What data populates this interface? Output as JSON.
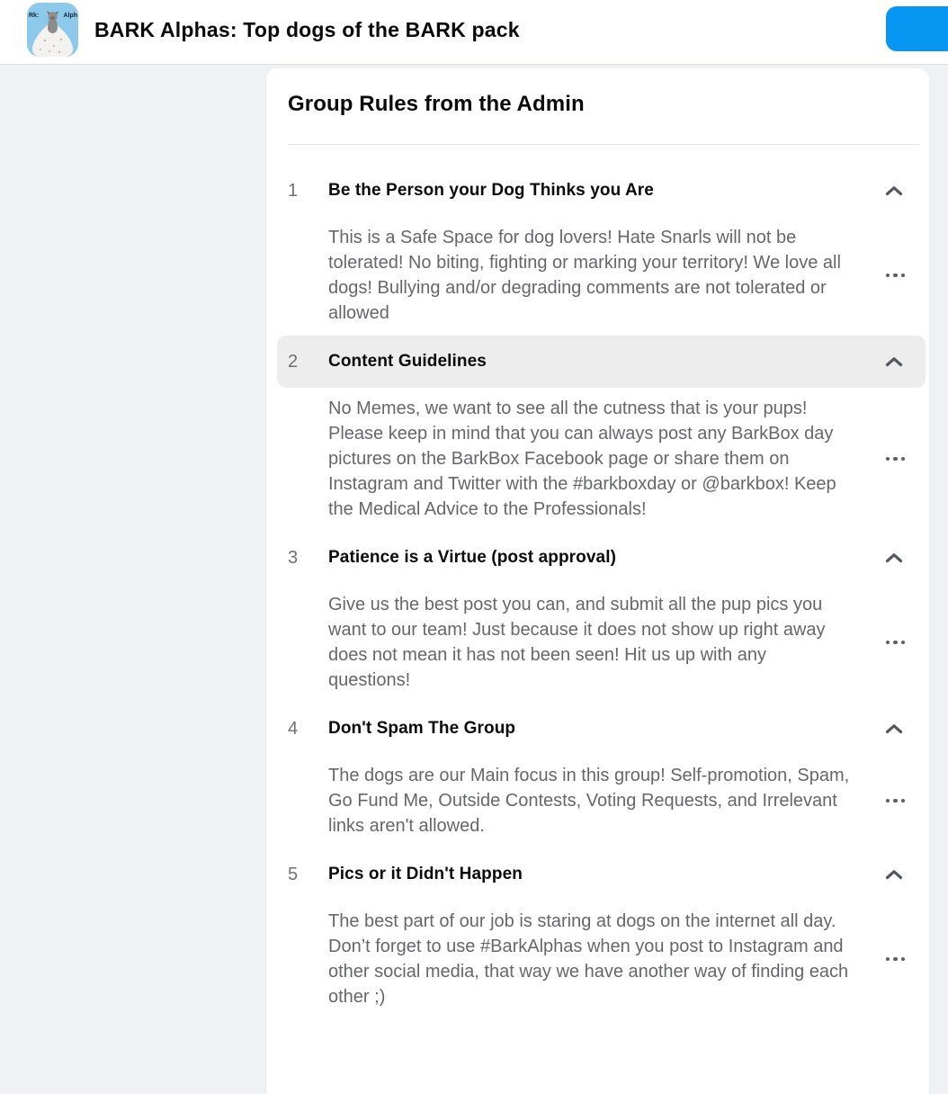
{
  "header": {
    "group_title": "BARK Alphas: Top dogs of the BARK pack",
    "avatar_text_left": "Rk:",
    "avatar_text_right": "Alph"
  },
  "rules_card": {
    "title": "Group Rules from the Admin",
    "rules": [
      {
        "number": "1",
        "title": "Be the Person your Dog Thinks you Are",
        "description": "This is a Safe Space for dog lovers! Hate Snarls will not be tolerated! No biting, fighting or marking your territory! We love all dogs! Bullying and/or degrading comments are not tolerated or allowed",
        "highlighted": false
      },
      {
        "number": "2",
        "title": "Content Guidelines",
        "description": "No Memes, we want to see all the cutness that is your pups! Please keep in mind that you can always post any BarkBox day pictures on the BarkBox Facebook page or share them on Instagram and Twitter with the #barkboxday or @barkbox! Keep the Medical Advice to the Professionals!",
        "highlighted": true
      },
      {
        "number": "3",
        "title": "Patience is a Virtue (post approval)",
        "description": "Give us the best post you can, and submit all the pup pics you want to our team! Just because it does not show up right away does not mean it has not been seen! Hit us up with any questions!",
        "highlighted": false
      },
      {
        "number": "4",
        "title": "Don't Spam The Group",
        "description": "The dogs are our Main focus in this group! Self-promotion, Spam, Go Fund Me, Outside Contests, Voting Requests, and Irrelevant links aren't allowed.",
        "highlighted": false
      },
      {
        "number": "5",
        "title": "Pics or it Didn't Happen",
        "description": "The best part of our job is staring at dogs on the internet all day. Don’t forget to use #BarkAlphas when you post to Instagram and other social media, that way we have another way of finding each other ;)",
        "highlighted": false
      }
    ]
  },
  "colors": {
    "accent_blue": "#0797f2",
    "page_bg": "#f0f1f4",
    "card_bg": "#ffffff",
    "highlight_bg": "#ededed",
    "text_primary": "#0a0a0c",
    "text_secondary": "#65676b",
    "avatar_bg": "#8dc9ea"
  }
}
